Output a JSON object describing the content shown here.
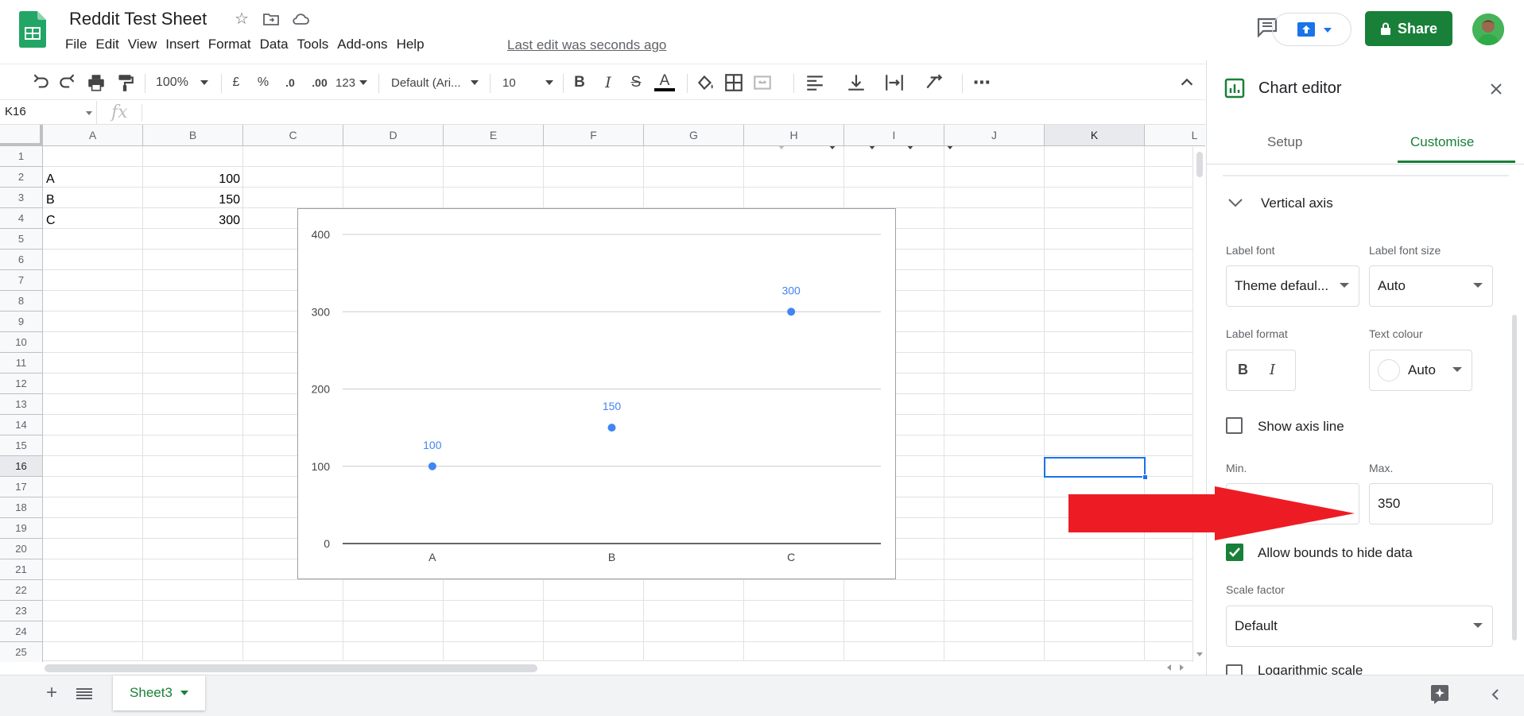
{
  "header": {
    "title": "Reddit Test Sheet",
    "menu": [
      "File",
      "Edit",
      "View",
      "Insert",
      "Format",
      "Data",
      "Tools",
      "Add-ons",
      "Help"
    ],
    "last_edit": "Last edit was seconds ago",
    "share_label": "Share"
  },
  "toolbar": {
    "zoom": "100%",
    "currency": "£",
    "percent": "%",
    "dec_less": ".0",
    "dec_more": ".00",
    "more_formats": "123",
    "font": "Default (Ari...",
    "font_size": "10",
    "bold": "B",
    "italic": "I",
    "strike": "S",
    "text_color": "A",
    "more": "⋯"
  },
  "formula_bar": {
    "cell_ref": "K16",
    "fx": "fx"
  },
  "grid": {
    "columns": [
      "A",
      "B",
      "C",
      "D",
      "E",
      "F",
      "G",
      "H",
      "I",
      "J",
      "K",
      "L"
    ],
    "rows": [
      "1",
      "2",
      "3",
      "4",
      "5",
      "6",
      "7",
      "8",
      "9",
      "10",
      "11",
      "12",
      "13",
      "14",
      "15",
      "16",
      "17",
      "18",
      "19",
      "20",
      "21",
      "22",
      "23",
      "24",
      "25"
    ],
    "cells": {
      "a2": "A",
      "b2": "100",
      "a3": "B",
      "b3": "150",
      "a4": "C",
      "b4": "300"
    },
    "selected": "K16"
  },
  "chart_data": {
    "type": "scatter",
    "categories": [
      "A",
      "B",
      "C"
    ],
    "values": [
      100,
      150,
      300
    ],
    "data_labels": [
      "100",
      "150",
      "300"
    ],
    "y_ticks": [
      "0",
      "100",
      "200",
      "300",
      "400"
    ],
    "ylim": [
      0,
      400
    ],
    "grid": true,
    "point_color": "#4285f4",
    "label_color": "#4285f4"
  },
  "sheets": {
    "active": "Sheet3"
  },
  "panel": {
    "title": "Chart editor",
    "tabs": [
      "Setup",
      "Customise"
    ],
    "active_tab": "Customise",
    "section": "Vertical axis",
    "label_font_label": "Label font",
    "label_font_value": "Theme defaul...",
    "label_font_size_label": "Label font size",
    "label_font_size_value": "Auto",
    "label_format_label": "Label format",
    "bold": "B",
    "italic": "I",
    "text_colour_label": "Text colour",
    "text_colour_value": "Auto",
    "show_axis_line": "Show axis line",
    "min_label": "Min.",
    "max_label": "Max.",
    "min_value": "",
    "max_value": "350",
    "allow_bounds": "Allow bounds to hide data",
    "allow_bounds_checked": true,
    "scale_factor_label": "Scale factor",
    "scale_factor_value": "Default",
    "log_scale": "Logarithmic scale"
  },
  "colors": {
    "accent": "#188038",
    "selection": "#1a73e8",
    "annotation_arrow": "#ed1c24"
  }
}
